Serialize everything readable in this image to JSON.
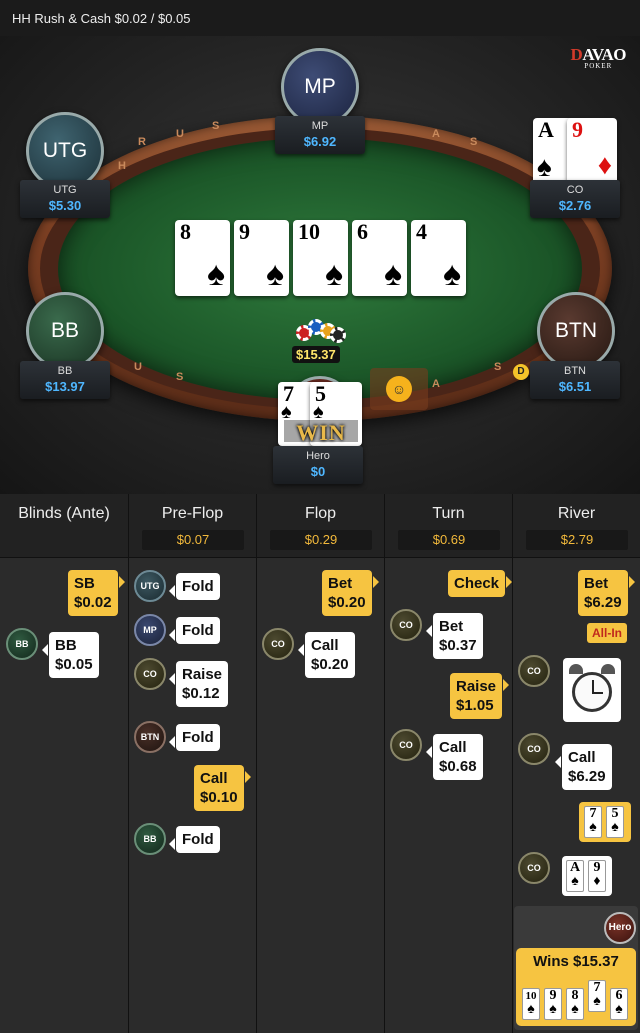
{
  "header": {
    "title": "HH  Rush & Cash $0.02 / $0.05"
  },
  "logo": {
    "line1a": "D",
    "line1b": "AVAO",
    "line2": "POKER"
  },
  "rail_letters": [
    "R",
    "U",
    "S",
    "H",
    "&",
    "C",
    "A",
    "S",
    "H",
    "U",
    "S",
    "H",
    "A",
    "S"
  ],
  "seats": {
    "mp": {
      "avatar": "MP",
      "name": "MP",
      "stack": "$6.92"
    },
    "utg": {
      "avatar": "UTG",
      "name": "UTG",
      "stack": "$5.30"
    },
    "co": {
      "name": "CO",
      "stack": "$2.76",
      "cards": [
        {
          "rank": "A",
          "suit": "♠"
        },
        {
          "rank": "9",
          "suit": "♦"
        }
      ]
    },
    "bb": {
      "avatar": "BB",
      "name": "BB",
      "stack": "$13.97"
    },
    "btn": {
      "avatar": "BTN",
      "name": "BTN",
      "stack": "$6.51"
    },
    "hero": {
      "name": "Hero",
      "stack": "$0",
      "cards": [
        {
          "rank": "7",
          "suit": "♠"
        },
        {
          "rank": "5",
          "suit": "♠"
        }
      ],
      "overlay": "WIN"
    }
  },
  "board": [
    {
      "rank": "8",
      "suit": "♠"
    },
    {
      "rank": "9",
      "suit": "♠"
    },
    {
      "rank": "10",
      "suit": "♠"
    },
    {
      "rank": "6",
      "suit": "♠"
    },
    {
      "rank": "4",
      "suit": "♠"
    }
  ],
  "pot": "$15.37",
  "dealer_button": "D",
  "history": {
    "columns": [
      {
        "title": "Blinds (Ante)",
        "pot": ""
      },
      {
        "title": "Pre-Flop",
        "pot": "$0.07"
      },
      {
        "title": "Flop",
        "pot": "$0.29"
      },
      {
        "title": "Turn",
        "pot": "$0.69"
      },
      {
        "title": "River",
        "pot": "$2.79"
      }
    ],
    "blinds": {
      "sb": "SB\n$0.02",
      "bb_tag": "BB",
      "bb": "BB\n$0.05"
    },
    "preflop": [
      {
        "tag": "UTG",
        "text": "Fold"
      },
      {
        "tag": "MP",
        "text": "Fold"
      },
      {
        "tag": "CO",
        "text": "Raise\n$0.12"
      },
      {
        "tag": "BTN",
        "text": "Fold"
      },
      {
        "hero": "Call\n$0.10"
      },
      {
        "tag": "BB",
        "text": "Fold"
      }
    ],
    "flop": {
      "hero": "Bet\n$0.20",
      "tag": "CO",
      "text": "Call\n$0.20"
    },
    "turn": {
      "hero_check": "Check",
      "tag1": "CO",
      "bet": "Bet\n$0.37",
      "hero_raise": "Raise\n$1.05",
      "tag2": "CO",
      "call": "Call\n$0.68"
    },
    "river": {
      "hero_bet": "Bet\n$6.29",
      "allin": "All-In",
      "tag1": "CO",
      "tag2": "CO",
      "call": "Call\n$6.29",
      "hero_show": [
        {
          "rank": "7",
          "suit": "♠"
        },
        {
          "rank": "5",
          "suit": "♠"
        }
      ],
      "tag3": "CO",
      "co_show": [
        {
          "rank": "A",
          "suit": "♠"
        },
        {
          "rank": "9",
          "suit": "♦"
        }
      ],
      "hero_tag": "Hero",
      "wins": "Wins $15.37",
      "win_cards": [
        {
          "rank": "10",
          "suit": "♠"
        },
        {
          "rank": "9",
          "suit": "♠"
        },
        {
          "rank": "8",
          "suit": "♠"
        },
        {
          "rank": "7",
          "suit": "♠"
        },
        {
          "rank": "6",
          "suit": "♠"
        }
      ]
    }
  }
}
